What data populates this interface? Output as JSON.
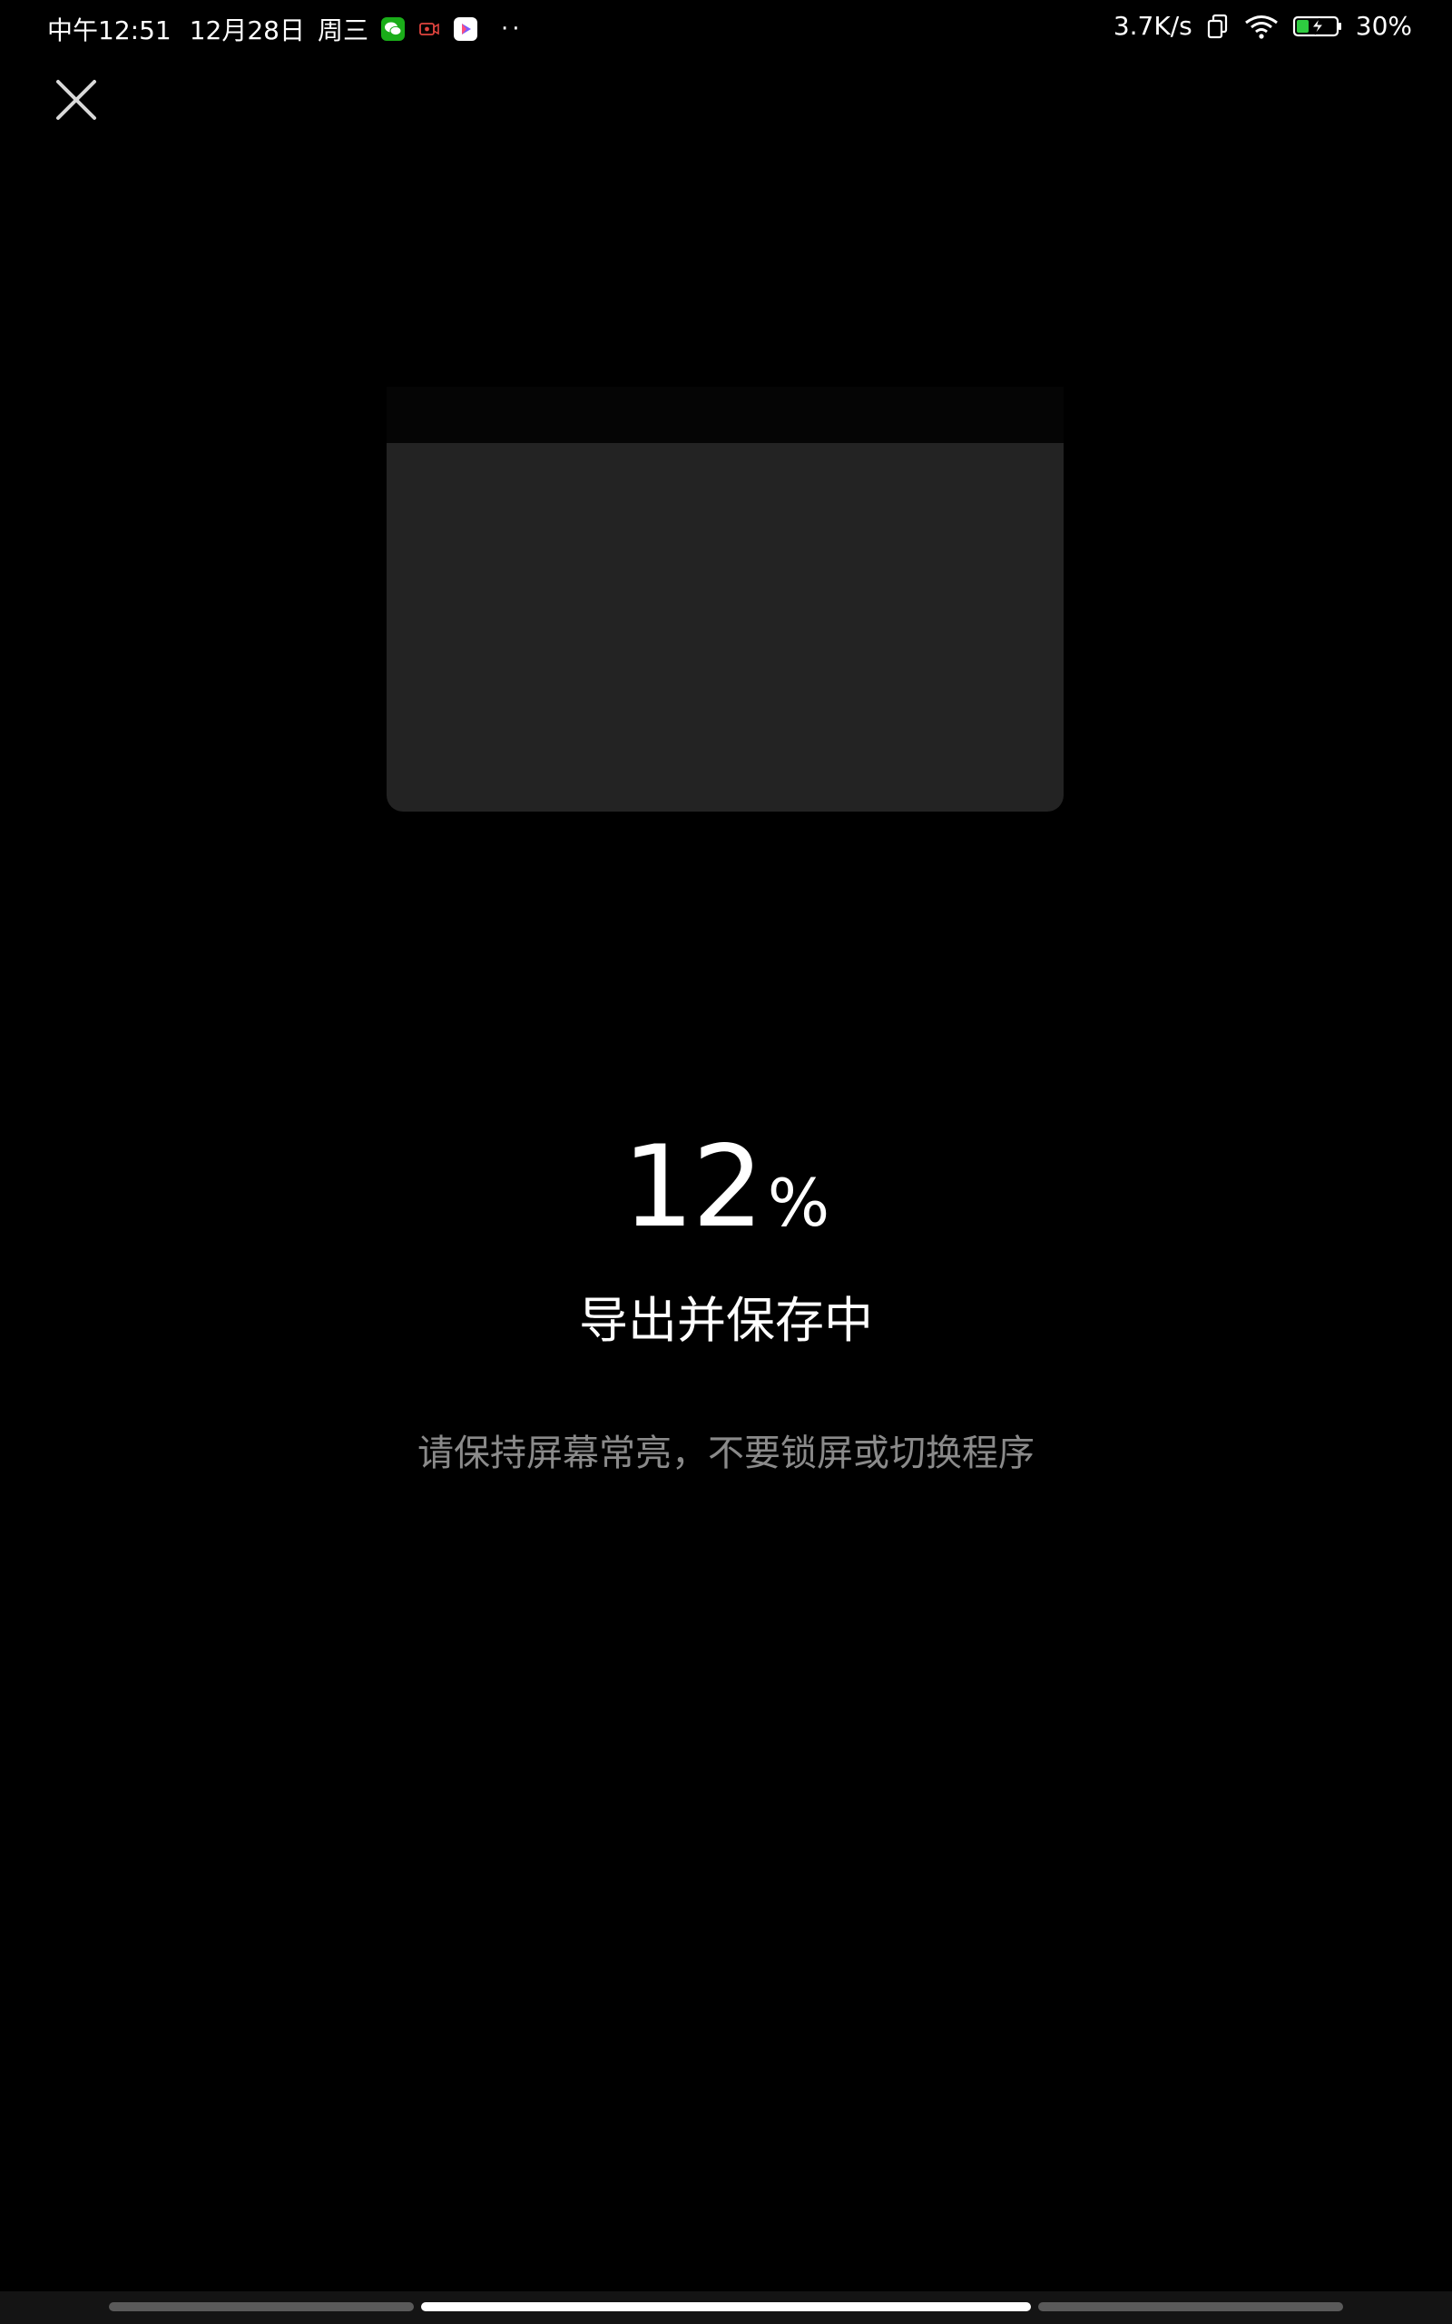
{
  "status_bar": {
    "time": "中午12:51",
    "date": "12月28日",
    "weekday": "周三",
    "more": "··",
    "network_speed": "3.7K/s",
    "battery": "30%"
  },
  "icons": {
    "close": "close-icon",
    "wechat": "wechat-icon",
    "screen_record": "screen-record-icon",
    "video_app": "video-app-icon",
    "dual_sim": "dual-sim-icon",
    "wifi": "wifi-icon",
    "battery": "battery-charging-icon"
  },
  "colors": {
    "background": "#000000",
    "preview": "#232323",
    "hint_text": "#8a8a8a",
    "wechat": "#1aad19",
    "battery_fill": "#2ecc40"
  },
  "export": {
    "progress_value": "12",
    "progress_unit": "%",
    "title": "导出并保存中",
    "hint": "请保持屏幕常亮，不要锁屏或切换程序"
  }
}
